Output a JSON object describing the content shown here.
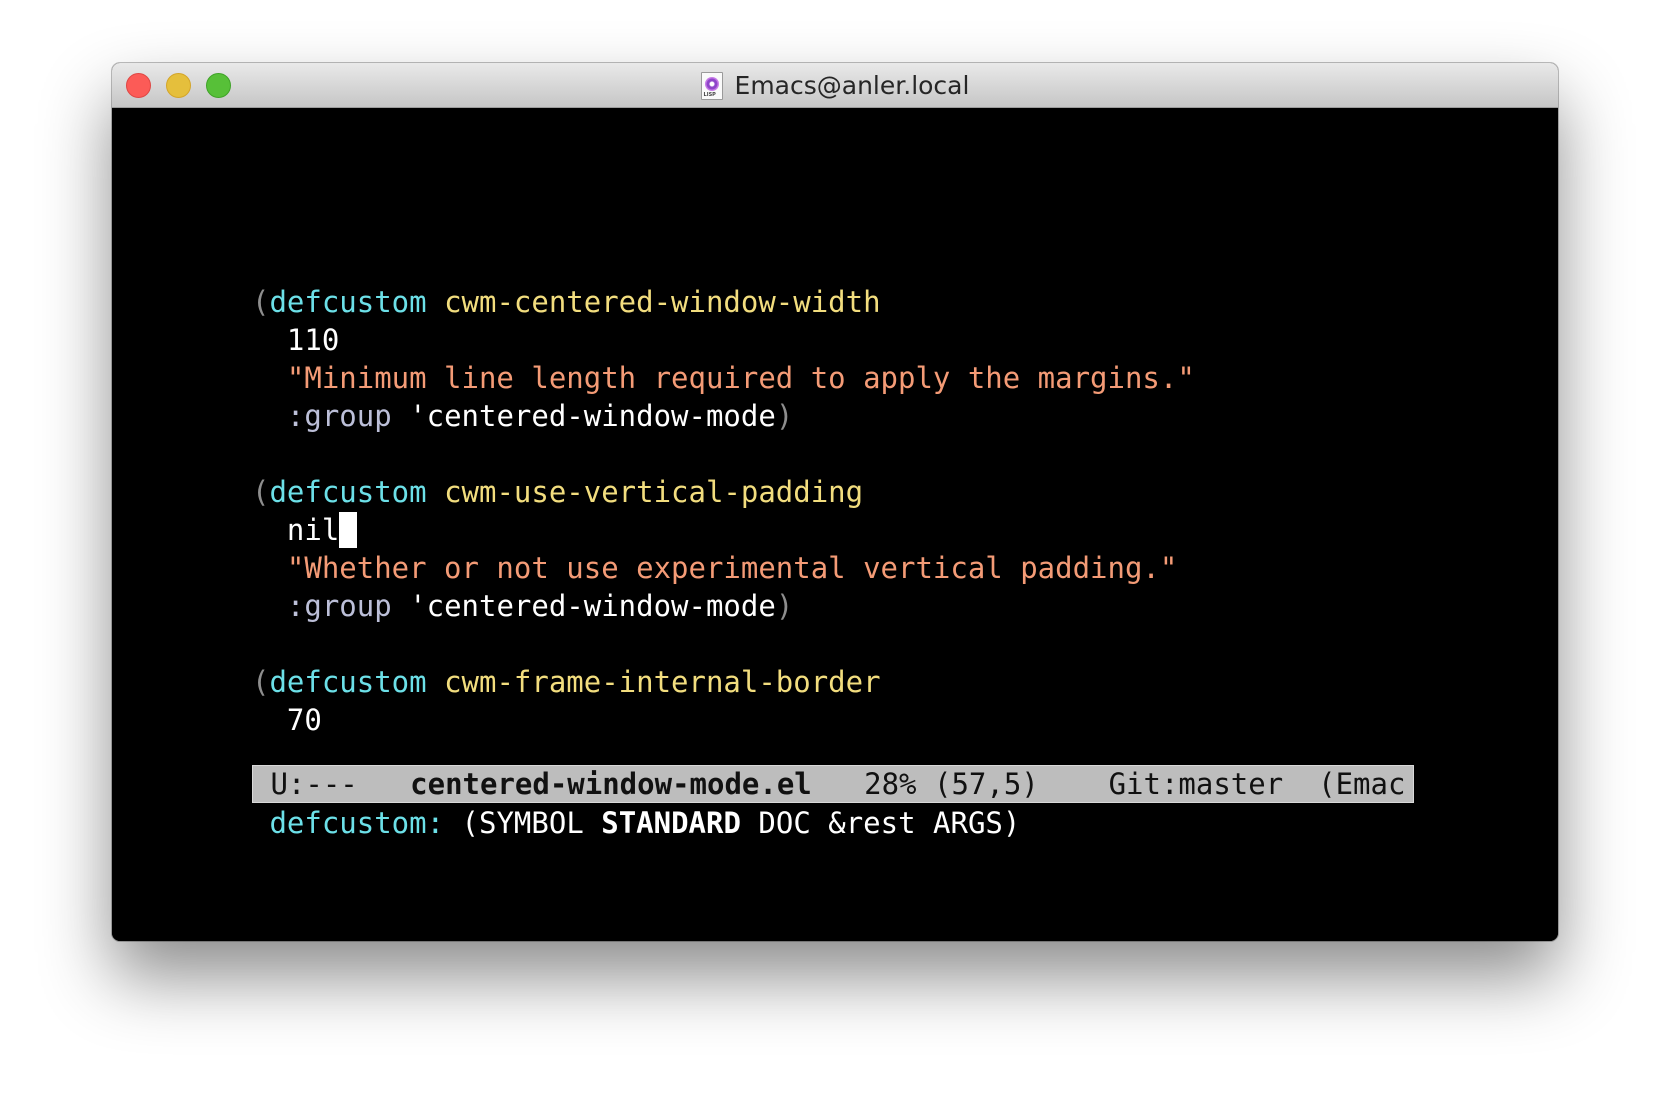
{
  "window": {
    "title": "Emacs@anler.local",
    "title_icon": "lisp-file-icon",
    "title_icon_tag": "LISP"
  },
  "colors": {
    "background": "#000000",
    "keyword": "#6ce0e8",
    "function_name": "#f2dd7e",
    "string": "#f49b76",
    "constant_key": "#bcbfd8",
    "paren": "#8e8e8e",
    "modeline_bg": "#bdbdbd"
  },
  "code": {
    "block1": {
      "open": "(",
      "keyword": "defcustom",
      "name": "cwm-centered-window-width",
      "value": "110",
      "doc": "\"Minimum line length required to apply the margins.\"",
      "group_key": ":group",
      "group_value": "'centered-window-mode",
      "close": ")"
    },
    "block2": {
      "open": "(",
      "keyword": "defcustom",
      "name": "cwm-use-vertical-padding",
      "value": "nil",
      "doc": "\"Whether or not use experimental vertical padding.\"",
      "group_key": ":group",
      "group_value": "'centered-window-mode",
      "close": ")"
    },
    "block3": {
      "open": "(",
      "keyword": "defcustom",
      "name": "cwm-frame-internal-border",
      "value_partial": "70"
    }
  },
  "modeline": {
    "status": "U:---",
    "buffer": "centered-window-mode.el",
    "position": "28% (57,5)",
    "vc": "Git:master",
    "mode": "(Emac"
  },
  "echo": {
    "keyword": "defcustom:",
    "open": "(",
    "arg1": "SYMBOL",
    "arg2": "STANDARD",
    "arg3": "DOC",
    "arg4": "&rest",
    "arg5": "ARGS",
    "close": ")"
  }
}
